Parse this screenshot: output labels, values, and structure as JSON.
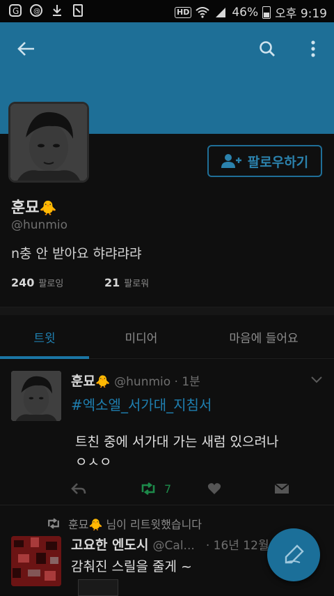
{
  "statusbar": {
    "network_badge": "HD",
    "battery": "46%",
    "time": "오후 9:19"
  },
  "profile": {
    "name": "훈묘",
    "name_emoji": "🐥",
    "handle": "@hunmio",
    "bio": "n충 안 받아요 햐랴랴랴",
    "follow_label": "팔로우하기",
    "following_count": "240",
    "following_label": "팔로잉",
    "followers_count": "21",
    "followers_label": "팔로워"
  },
  "tabs": [
    {
      "label": "트윗",
      "active": true
    },
    {
      "label": "미디어",
      "active": false
    },
    {
      "label": "마음에 들어요",
      "active": false
    }
  ],
  "tweets": [
    {
      "name": "훈묘",
      "handle_time": "@hunmio · 1분",
      "hashtag": "#엑소엘_서가대_지침서",
      "body": " 트친 중에 서가대 가는 새럼 있으려나\n ㅇㅅㅇ",
      "retweet_count": "7"
    },
    {
      "retweet_note": "훈묘🐥 님이 리트윗했습니다",
      "name": "고요한 엔도시",
      "handle": "@Cal...",
      "time": "· 16년 12월",
      "body": "감춰진 스릴을 줄게 ~"
    }
  ],
  "colors": {
    "accent": "#1f7fb0",
    "header": "#1e6f97",
    "retweet": "#1d8a4a",
    "background": "#0f0f0f"
  },
  "icons": [
    "back-arrow-icon",
    "search-icon",
    "more-vert-icon",
    "add-user-icon",
    "chevron-down-icon",
    "reply-icon",
    "retweet-icon",
    "heart-icon",
    "dm-icon",
    "compose-icon"
  ]
}
